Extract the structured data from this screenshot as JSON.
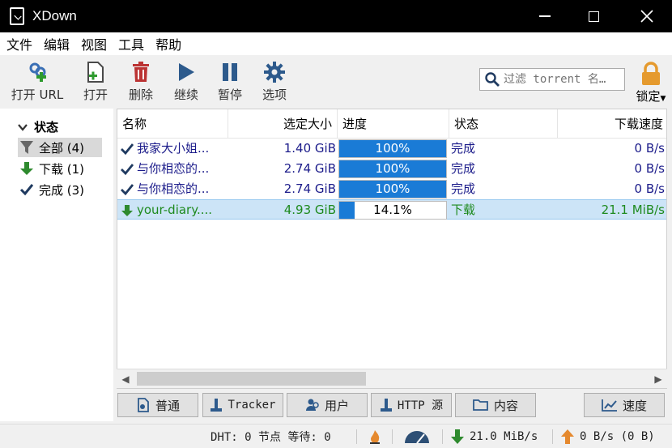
{
  "window": {
    "title": "XDown"
  },
  "menu": [
    "文件",
    "编辑",
    "视图",
    "工具",
    "帮助"
  ],
  "toolbar": {
    "open_url": "打开 URL",
    "open": "打开",
    "delete": "删除",
    "resume": "继续",
    "pause": "暂停",
    "options": "选项",
    "search_placeholder": "过滤 torrent 名…",
    "lock": "锁定"
  },
  "sidebar": {
    "header": "状态",
    "items": [
      {
        "label": "全部 (4)",
        "icon": "filter-icon"
      },
      {
        "label": "下载 (1)",
        "icon": "down-arrow-icon"
      },
      {
        "label": "完成 (3)",
        "icon": "checkmark-icon"
      }
    ]
  },
  "table": {
    "columns": [
      "名称",
      "选定大小",
      "进度",
      "状态",
      "下载速度"
    ],
    "rows": [
      {
        "name": "我家大小姐...",
        "size": "1.40 GiB",
        "progress": "100%",
        "progress_value": 1.0,
        "state": "完成",
        "speed": "0 B/s",
        "icon": "checkmark-icon"
      },
      {
        "name": "与你相恋的...",
        "size": "2.74 GiB",
        "progress": "100%",
        "progress_value": 1.0,
        "state": "完成",
        "speed": "0 B/s",
        "icon": "checkmark-icon"
      },
      {
        "name": "与你相恋的...",
        "size": "2.74 GiB",
        "progress": "100%",
        "progress_value": 1.0,
        "state": "完成",
        "speed": "0 B/s",
        "icon": "checkmark-icon"
      },
      {
        "name": "your-diary....",
        "size": "4.93 GiB",
        "progress": "14.1%",
        "progress_value": 0.141,
        "state": "下载",
        "speed": "21.1 MiB/s",
        "icon": "down-arrow-icon"
      }
    ]
  },
  "tabs": {
    "general": "普通",
    "tracker": "Tracker",
    "peers": "用户",
    "http": "HTTP 源",
    "content": "内容",
    "speed": "速度"
  },
  "status": {
    "dht": "DHT: 0 节点 等待: 0",
    "download": "21.0 MiB/s",
    "upload": "0 B/s (0 B)"
  },
  "colors": {
    "progress_fill": "#1a7bd6",
    "done_text": "#1b1b8a",
    "downloading_text": "#1e8a1e",
    "selected_row": "#cce4f7"
  }
}
